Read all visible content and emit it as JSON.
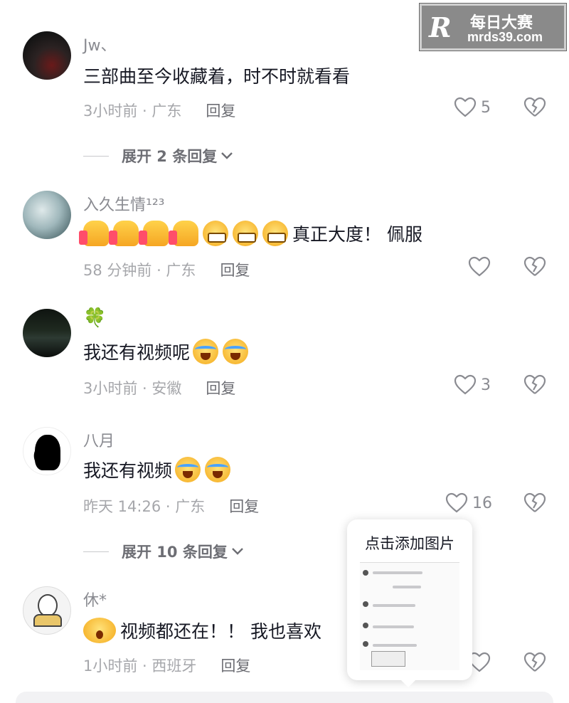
{
  "watermark": {
    "logo": "R",
    "line1": "每日大赛",
    "line2": "mrds39.com"
  },
  "comments": [
    {
      "name": "Jw、",
      "text": "三部曲至今收藏着，时不时就看看",
      "time_location": "3小时前 · 广东",
      "reply_label": "回复",
      "like_count": "5",
      "expand_label": "展开 2 条回复"
    },
    {
      "name": "入久生情¹²³",
      "text": "真正大度！ 佩服",
      "time_location": "58 分钟前 · 广东",
      "reply_label": "回复",
      "like_count": ""
    },
    {
      "name": "🍀",
      "text": "我还有视频呢",
      "time_location": "3小时前 · 安徽",
      "reply_label": "回复",
      "like_count": "3"
    },
    {
      "name": "八月",
      "text": "我还有视频",
      "time_location": "昨天 14:26 · 广东",
      "reply_label": "回复",
      "like_count": "16",
      "expand_label": "展开 10 条回复"
    },
    {
      "name": "休*",
      "text": "视频都还在！！  我也喜欢",
      "time_location": "1小时前 · 西班牙",
      "reply_label": "回复",
      "like_count": ""
    }
  ],
  "popup": {
    "title": "点击添加图片"
  },
  "icons": {
    "like": "heart-outline-icon",
    "dislike": "broken-heart-icon",
    "expand": "chevron-down-icon"
  }
}
